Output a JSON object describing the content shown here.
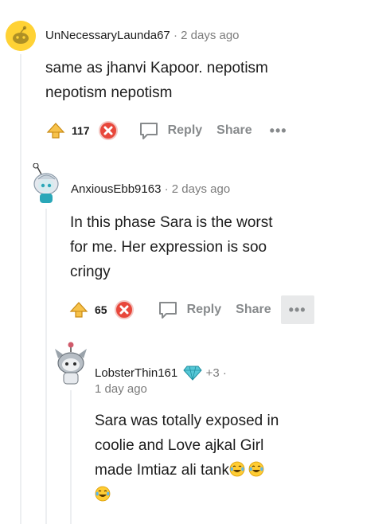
{
  "comments": [
    {
      "username": "UnNecessaryLaunda67",
      "separator": "·",
      "time": "2 days ago",
      "body": [
        "same as jhanvi Kapoor. nepotism",
        "nepotism nepotism"
      ],
      "score": "117",
      "reply_label": "Reply",
      "share_label": "Share",
      "more_label": "•••"
    },
    {
      "username": "AnxiousEbb9163",
      "separator": "·",
      "time": "2 days ago",
      "body": [
        "In this phase Sara is the worst",
        "for me. Her expression is soo",
        "cringy"
      ],
      "score": "65",
      "reply_label": "Reply",
      "share_label": "Share",
      "more_label": "•••"
    },
    {
      "username": "LobsterThin161",
      "badge_count": "+3",
      "separator": "·",
      "time": "1 day ago",
      "body": [
        "Sara was totally exposed in",
        "coolie and Love ajkal Girl",
        "made Imtiaz ali tank"
      ]
    }
  ],
  "colors": {
    "upvote": "#f5a623",
    "downvote": "#e8473b",
    "meta_gray": "#7c7c7c",
    "action_gray": "#878a8c",
    "badge_teal": "#2aa7b8"
  },
  "icons": {
    "upvote": "upvote-arrow-icon",
    "downvote": "downvote-x-icon",
    "reply": "speech-bubble-icon",
    "emoji": "laughing-tears-emoji"
  }
}
